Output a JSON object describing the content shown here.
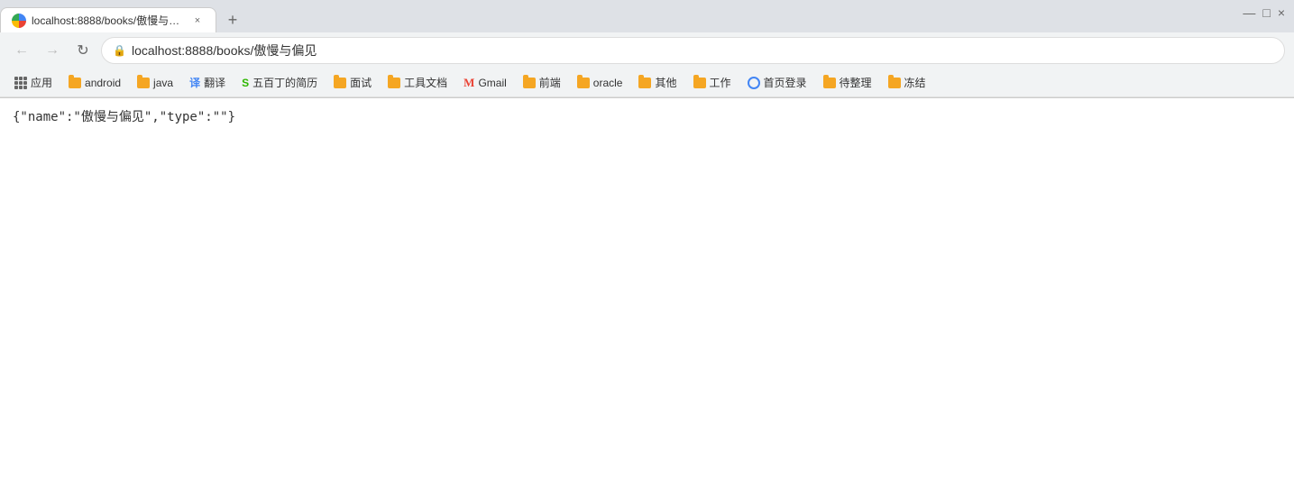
{
  "tab": {
    "favicon_alt": "browser-favicon",
    "title": "localhost:8888/books/傲慢与偏...",
    "close_label": "×"
  },
  "new_tab_label": "+",
  "window_controls": {
    "minimize": "—",
    "maximize": "□",
    "close": "×"
  },
  "address_bar": {
    "back_label": "←",
    "forward_label": "→",
    "reload_label": "↻",
    "lock_icon": "🔒",
    "url": "localhost:8888/books/傲慢与偏见"
  },
  "bookmarks": [
    {
      "id": "apps",
      "type": "apps",
      "label": "应用"
    },
    {
      "id": "android",
      "type": "folder",
      "label": "android"
    },
    {
      "id": "java",
      "type": "folder",
      "label": "java"
    },
    {
      "id": "translate",
      "type": "translate",
      "label": "翻译"
    },
    {
      "id": "wuba",
      "type": "wuba",
      "label": "五百丁的简历"
    },
    {
      "id": "mianshi",
      "type": "folder",
      "label": "面试"
    },
    {
      "id": "tools",
      "type": "folder",
      "label": "工具文档"
    },
    {
      "id": "gmail",
      "type": "gmail",
      "label": "Gmail"
    },
    {
      "id": "frontend",
      "type": "folder",
      "label": "前端"
    },
    {
      "id": "oracle",
      "type": "folder",
      "label": "oracle"
    },
    {
      "id": "other",
      "type": "folder",
      "label": "其他"
    },
    {
      "id": "work",
      "type": "folder",
      "label": "工作"
    },
    {
      "id": "homepage",
      "type": "globe",
      "label": "首页登录"
    },
    {
      "id": "pending",
      "type": "folder",
      "label": "待整理"
    },
    {
      "id": "frozen",
      "type": "folder",
      "label": "冻结"
    }
  ],
  "page": {
    "content": "{\"name\":\"傲慢与偏见\",\"type\":\"\"}"
  }
}
